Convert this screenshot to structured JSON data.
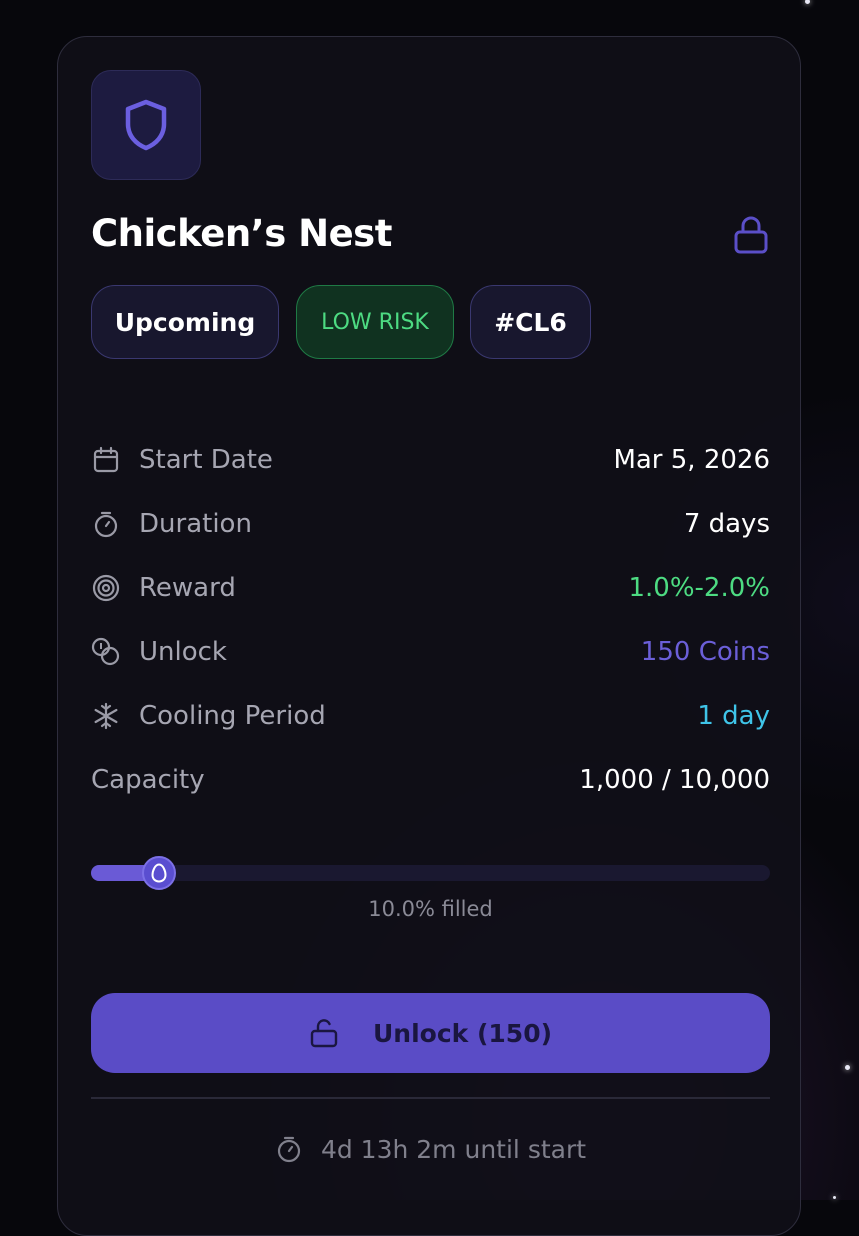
{
  "card": {
    "title": "Chicken’s Nest",
    "icons": {
      "tile": "shield-icon",
      "corner": "lock-icon"
    },
    "badges": {
      "status": "Upcoming",
      "risk": "LOW RISK",
      "code": "#CL6"
    },
    "details": [
      {
        "icon": "calendar-icon",
        "label": "Start Date",
        "value": "Mar 5, 2026",
        "color": "#ffffff"
      },
      {
        "icon": "stopwatch-icon",
        "label": "Duration",
        "value": "7 days",
        "color": "#ffffff"
      },
      {
        "icon": "target-icon",
        "label": "Reward",
        "value": "1.0%-2.0%",
        "color": "#4ddb82"
      },
      {
        "icon": "coins-icon",
        "label": "Unlock",
        "value": "150 Coins",
        "color": "#6b5fd8"
      },
      {
        "icon": "snowflake-icon",
        "label": "Cooling Period",
        "value": "1 day",
        "color": "#3fc4e8"
      },
      {
        "icon": "",
        "label": "Capacity",
        "value": "1,000 / 10,000",
        "color": "#ffffff"
      }
    ],
    "progress": {
      "fraction": 0.1,
      "text": "10.0% filled",
      "knob_icon": "egg-icon"
    },
    "unlock_button": {
      "label": "Unlock (150)",
      "icon": "unlock-icon"
    },
    "footer": {
      "icon": "stopwatch-icon",
      "text": "4d 13h 2m until start"
    }
  },
  "colors": {
    "accent": "#5a4cc6",
    "green": "#4ddb82",
    "purple": "#6b5fd8",
    "cyan": "#3fc4e8"
  }
}
